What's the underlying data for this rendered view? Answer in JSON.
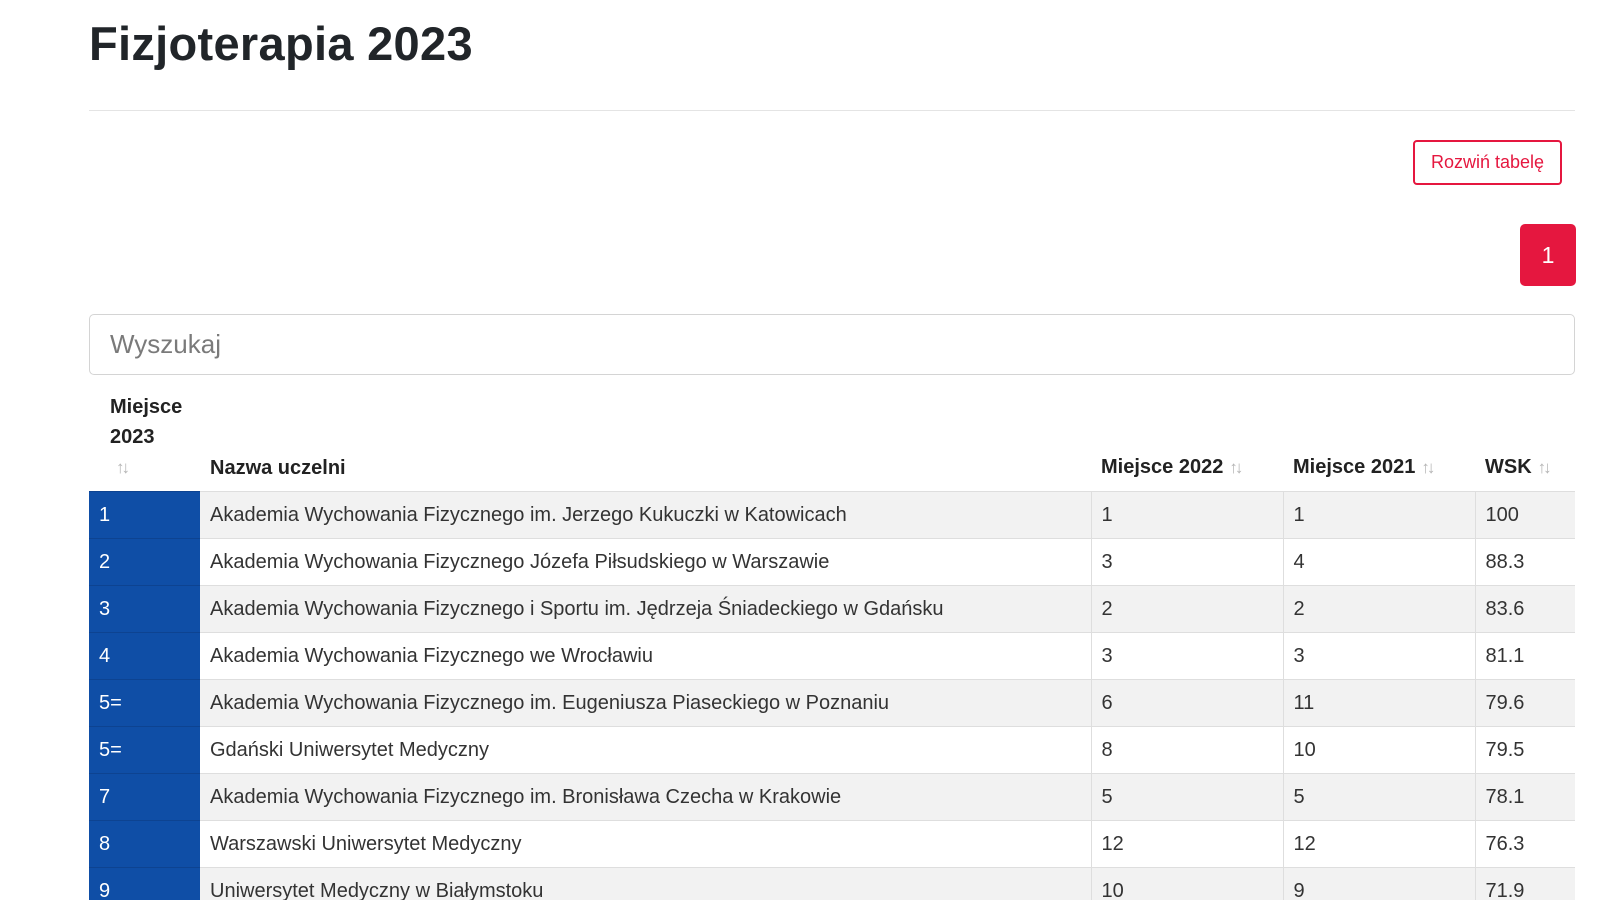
{
  "page": {
    "title": "Fizjoterapia 2023"
  },
  "toolbar": {
    "expand_label": "Rozwiń tabelę"
  },
  "pagination": {
    "current_page": "1"
  },
  "search": {
    "placeholder": "Wyszukaj",
    "value": ""
  },
  "table": {
    "headers": {
      "rank_2023": "Miejsce 2023",
      "name": "Nazwa uczelni",
      "rank_2022": "Miejsce 2022",
      "rank_2021": "Miejsce 2021",
      "wsk": "WSK"
    },
    "sort_icon": "sort-arrows-icon",
    "rows": [
      {
        "rank": "1",
        "name": "Akademia Wychowania Fizycznego im. Jerzego Kukuczki w Katowicach",
        "r2022": "1",
        "r2021": "1",
        "wsk": "100"
      },
      {
        "rank": "2",
        "name": "Akademia Wychowania Fizycznego Józefa Piłsudskiego w Warszawie",
        "r2022": "3",
        "r2021": "4",
        "wsk": "88.3"
      },
      {
        "rank": "3",
        "name": "Akademia Wychowania Fizycznego i Sportu im. Jędrzeja Śniadeckiego w Gdańsku",
        "r2022": "2",
        "r2021": "2",
        "wsk": "83.6"
      },
      {
        "rank": "4",
        "name": "Akademia Wychowania Fizycznego we Wrocławiu",
        "r2022": "3",
        "r2021": "3",
        "wsk": "81.1"
      },
      {
        "rank": "5=",
        "name": "Akademia Wychowania Fizycznego im. Eugeniusza Piaseckiego w Poznaniu",
        "r2022": "6",
        "r2021": "11",
        "wsk": "79.6"
      },
      {
        "rank": "5=",
        "name": "Gdański Uniwersytet Medyczny",
        "r2022": "8",
        "r2021": "10",
        "wsk": "79.5"
      },
      {
        "rank": "7",
        "name": "Akademia Wychowania Fizycznego im. Bronisława Czecha w Krakowie",
        "r2022": "5",
        "r2021": "5",
        "wsk": "78.1"
      },
      {
        "rank": "8",
        "name": "Warszawski Uniwersytet Medyczny",
        "r2022": "12",
        "r2021": "12",
        "wsk": "76.3"
      },
      {
        "rank": "9",
        "name": "Uniwersytet Medyczny w Białymstoku",
        "r2022": "10",
        "r2021": "9",
        "wsk": "71.9"
      }
    ]
  },
  "colors": {
    "accent": "#e5173f",
    "rank_column": "#0f4ea6"
  }
}
